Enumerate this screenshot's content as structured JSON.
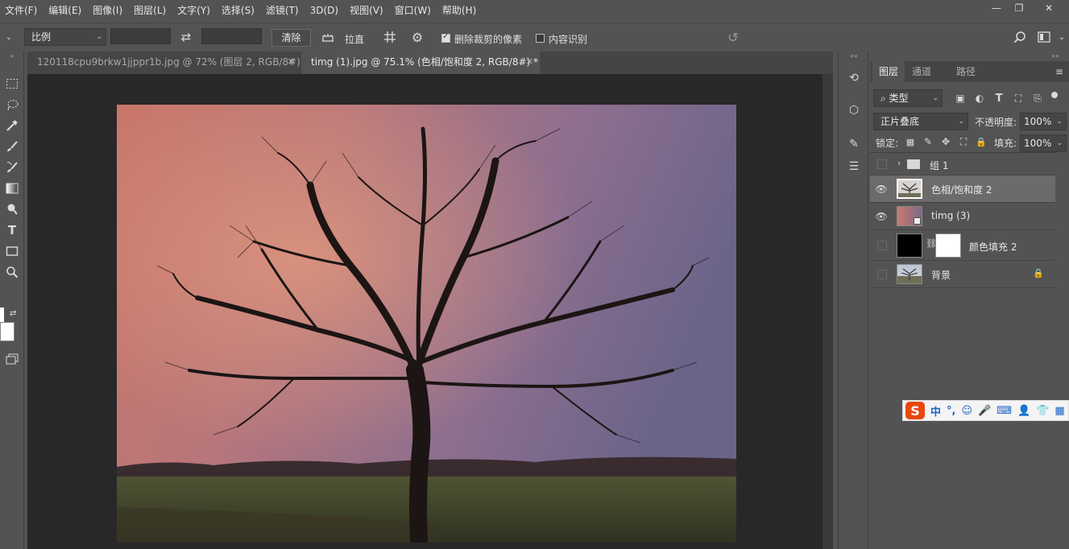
{
  "menu": [
    "文件(F)",
    "编辑(E)",
    "图像(I)",
    "图层(L)",
    "文字(Y)",
    "选择(S)",
    "滤镜(T)",
    "3D(D)",
    "视图(V)",
    "窗口(W)",
    "帮助(H)"
  ],
  "window_controls": {
    "minimize": "—",
    "restore": "❐",
    "close": "✕"
  },
  "options": {
    "ratio_select": "比例",
    "clear_button": "清除",
    "straighten_label": "拉直",
    "delete_cropped": "删除裁剪的像素",
    "delete_cropped_checked": true,
    "content_aware": "内容识别",
    "content_aware_checked": false
  },
  "tabs": [
    {
      "label": "120118cpu9brkw1jjppr1b.jpg @ 72% (图层 2, RGB/8#) *",
      "close": "✕"
    },
    {
      "label": "timg (1).jpg @ 75.1% (色相/饱和度 2, RGB/8#) *",
      "close": "✕"
    }
  ],
  "panel": {
    "tabs": [
      "图层",
      "通道",
      "路径"
    ],
    "kind_select": "类型",
    "blend_mode": "正片叠底",
    "opacity_label": "不透明度:",
    "opacity_value": "100%",
    "lock_label": "锁定:",
    "fill_label": "填充:",
    "fill_value": "100%",
    "collapse_left": "««",
    "collapse_right": "»»"
  },
  "layers": [
    {
      "name": "组 1",
      "visible": false,
      "type": "group"
    },
    {
      "name": "色相/饱和度 2",
      "visible": true,
      "type": "adjustment",
      "selected": true
    },
    {
      "name": "timg (3)",
      "visible": true,
      "type": "image"
    },
    {
      "name": "颜色填充 2",
      "visible": false,
      "type": "fill"
    },
    {
      "name": "背景",
      "visible": false,
      "type": "background",
      "locked": true
    }
  ],
  "ime": {
    "logo": "S",
    "items": [
      "中",
      "°,",
      "☺",
      "🎤",
      "⌨",
      "👤",
      "👕",
      "▦"
    ]
  },
  "colors": {
    "ui_bg": "#535353",
    "canvas_bg": "#282828",
    "ime_red": "#e8470e",
    "ime_blue": "#1a62c5"
  }
}
